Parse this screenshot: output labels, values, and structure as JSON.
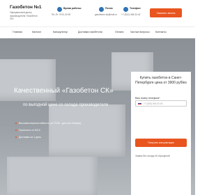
{
  "header": {
    "logo_title": "Газобетон №1",
    "logo_sub": "Официальный дилер производителя «Газобетон СК»",
    "schedule_title": "Время работы:",
    "schedule_text": "Пн–Пт: 9:00–20:00",
    "email_title": "Почта:",
    "email_text": "gazobeton-sk@mail.ru",
    "phone_title": "Телефон:",
    "phone_text": "+7 (812) 408-33-42",
    "callback_label": "Заказать звонок"
  },
  "nav": {
    "items": [
      "Главная",
      "Каталог",
      "Калькулятор",
      "Доставка газобетона",
      "Оплата",
      "Частые вопросы",
      "Контакты"
    ]
  },
  "hero": {
    "title": "Качественный «Газобетон СК»",
    "subtitle": "по выгодной цене со склада производителя",
    "bullets": [
      "Высокая морозостойкость (от F100 - для зон Севера)",
      "Прочность от В2,5",
      "Доставка за 1 день"
    ]
  },
  "form": {
    "title": "Купить газобетон в Санкт-Петербурге цена от 3900 рубles",
    "phone_label": "Ваш номер телефона*",
    "phone_placeholder": "+7 (000) 000-00-00",
    "submit_label": "Получить консультацию",
    "note": "Заявка без склада 45 обращений"
  }
}
